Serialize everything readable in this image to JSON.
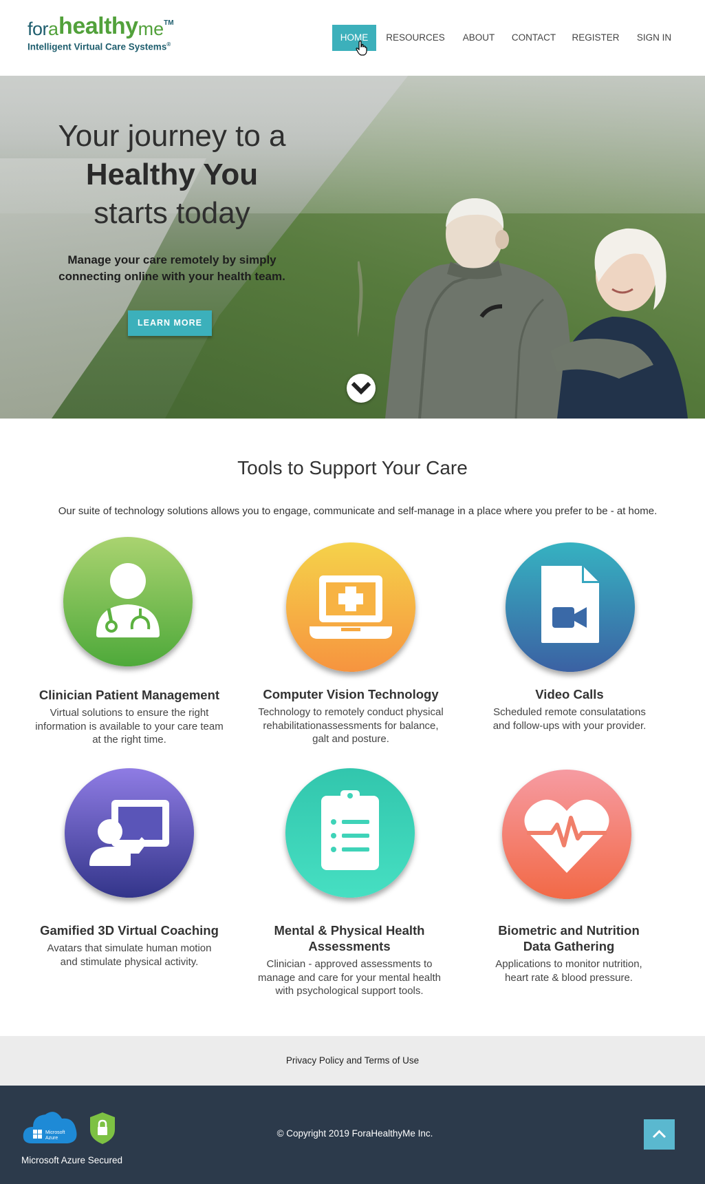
{
  "logo": {
    "fora": "for",
    "a": "a",
    "healthy": "healthy",
    "me": "me",
    "tm": "TM",
    "tagline": "Intelligent Virtual Care Systems",
    "registered": "®"
  },
  "nav": {
    "items": [
      {
        "label": "HOME",
        "active": true
      },
      {
        "label": "RESOURCES",
        "active": false
      },
      {
        "label": "ABOUT",
        "active": false
      },
      {
        "label": "CONTACT",
        "active": false
      },
      {
        "label": "REGISTER",
        "active": false
      },
      {
        "label": "SIGN IN",
        "active": false
      }
    ]
  },
  "hero": {
    "line1": "Your journey to a",
    "line2": "Healthy You",
    "line3": "starts today",
    "subtitle_1": "Manage your care remotely by simply",
    "subtitle_2": "connecting online with your health team.",
    "button": "LEARN MORE",
    "scroll_icon": "chevron-down-icon"
  },
  "tools": {
    "title": "Tools to Support Your Care",
    "description": "Our suite of technology solutions allows you to engage, communicate and self-manage in a place where you prefer to be - at home.",
    "features": [
      {
        "title": "Clinician Patient Management",
        "text": [
          "Virtual solutions to ensure the right",
          "information is available to your care team",
          "at the right time."
        ],
        "icon": "doctor-icon",
        "color_top": "#a6d36b",
        "color_bottom": "#4eaa3a"
      },
      {
        "title": "Computer Vision Technology",
        "text": [
          "Technology to remotely conduct physical",
          "rehabilitationassessments for balance,",
          "galt and posture."
        ],
        "icon": "laptop-medical-icon",
        "color_top": "#f6d048",
        "color_bottom": "#f6953e"
      },
      {
        "title": "Video Calls",
        "text": [
          "Scheduled remote consulatations",
          "and follow-ups with your provider."
        ],
        "icon": "video-file-icon",
        "color_top": "#37b0c0",
        "color_bottom": "#3a63a4"
      },
      {
        "title": "Gamified 3D Virtual Coaching",
        "text": [
          "Avatars that simulate human motion",
          "and stimulate physical activity."
        ],
        "icon": "presenter-icon",
        "color_top": "#8f7be4",
        "color_bottom": "#34358a"
      },
      {
        "title_lines": [
          "Mental & Physical Health",
          "Assessments"
        ],
        "text": [
          "Clinician - approved assessments to",
          "manage and care for your mental health",
          "with  psychological support tools."
        ],
        "icon": "clipboard-list-icon",
        "color_top": "#33c9b0",
        "color_bottom": "#46e0c2"
      },
      {
        "title_lines": [
          "Biometric and Nutrition",
          "Data Gathering"
        ],
        "text": [
          "Applications to monitor nutrition,",
          "heart rate & blood pressure."
        ],
        "icon": "heartbeat-icon",
        "color_top": "#f59aa1",
        "color_bottom": "#f26a46"
      }
    ]
  },
  "footer": {
    "policy_link": "Privacy Policy and Terms of Use",
    "azure_label": "Microsoft Azure Secured",
    "azure_logo_text_1": "Microsoft",
    "azure_logo_text_2": "Azure",
    "copyright": "© Copyright  2019  ForaHealthyMe Inc.",
    "to_top_icon": "chevron-up-icon"
  }
}
